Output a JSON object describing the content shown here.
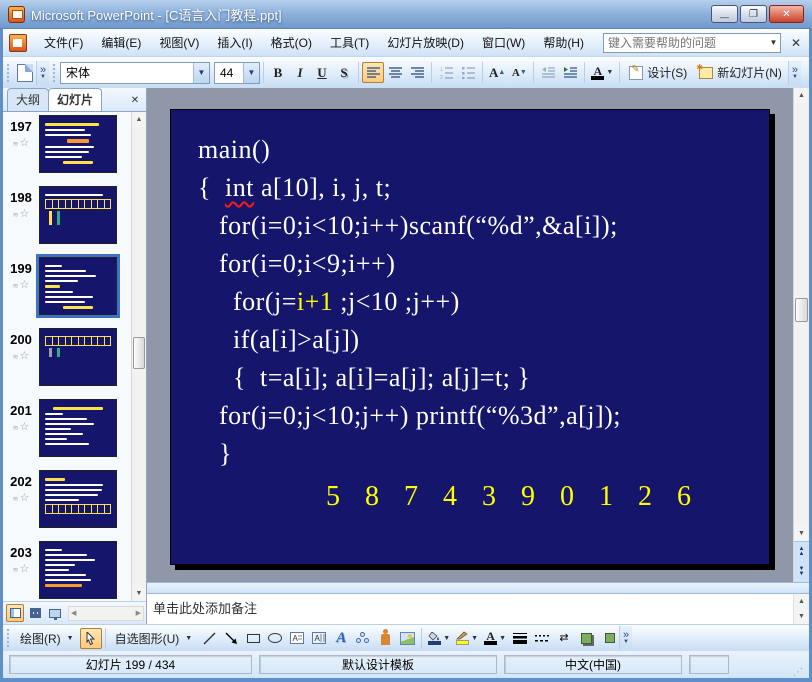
{
  "window": {
    "title": "Microsoft PowerPoint - [C语言入门教程.ppt]"
  },
  "menu": {
    "items": [
      {
        "key": "file",
        "label": "文件(F)"
      },
      {
        "key": "edit",
        "label": "编辑(E)"
      },
      {
        "key": "view",
        "label": "视图(V)"
      },
      {
        "key": "insert",
        "label": "插入(I)"
      },
      {
        "key": "format",
        "label": "格式(O)"
      },
      {
        "key": "tools",
        "label": "工具(T)"
      },
      {
        "key": "slideshow",
        "label": "幻灯片放映(D)"
      },
      {
        "key": "window",
        "label": "窗口(W)"
      },
      {
        "key": "help",
        "label": "帮助(H)"
      }
    ],
    "help_placeholder": "键入需要帮助的问题"
  },
  "format_toolbar": {
    "font_name": "宋体",
    "font_size": "44",
    "bold": "B",
    "italic": "I",
    "underline": "U",
    "shadow": "S",
    "font_grow": "A",
    "font_shrink": "A",
    "font_color": "A",
    "design": "设计(S)",
    "new_slide": "新幻灯片(N)"
  },
  "slides_panel": {
    "tabs": {
      "outline": "大纲",
      "slides": "幻灯片"
    },
    "thumbnails": [
      {
        "number": "197",
        "variant": "title-text",
        "selected": false
      },
      {
        "number": "198",
        "variant": "array-boxes",
        "selected": false
      },
      {
        "number": "199",
        "variant": "code-text",
        "selected": true
      },
      {
        "number": "200",
        "variant": "array-boxes-top",
        "selected": false
      },
      {
        "number": "201",
        "variant": "title-text2",
        "selected": false
      },
      {
        "number": "202",
        "variant": "text-boxes-bottom",
        "selected": false
      },
      {
        "number": "203",
        "variant": "code-text2",
        "selected": false
      }
    ]
  },
  "slide": {
    "code_lines": [
      {
        "segments": [
          {
            "text": "main()"
          }
        ]
      },
      {
        "segments": [
          {
            "text": "{  "
          },
          {
            "text": "int",
            "style": "misspelled"
          },
          {
            "text": " a[10], i, j, t;"
          }
        ]
      },
      {
        "segments": [
          {
            "text": "   for(i=0;i<10;i++)scanf(“%d”,&a[i]);"
          }
        ]
      },
      {
        "segments": [
          {
            "text": "   for(i=0;i<9;i++)"
          }
        ]
      },
      {
        "segments": [
          {
            "text": "     for(j="
          },
          {
            "text": "i+1",
            "style": "highlight"
          },
          {
            "text": " ;j<10 ;j++)"
          }
        ]
      },
      {
        "segments": [
          {
            "text": "     if(a[i]>a[j])"
          }
        ]
      },
      {
        "segments": [
          {
            "text": "     {  t=a[i]; a[i]=a[j]; a[j]=t; }"
          }
        ]
      },
      {
        "segments": [
          {
            "text": "   for(j=0;j<10;j++) printf(“%3d”,a[j]);"
          }
        ]
      },
      {
        "segments": [
          {
            "text": "   }"
          }
        ]
      }
    ],
    "output_line": "5 8 7 4 3 9 0 1 2 6"
  },
  "notes": {
    "placeholder": "单击此处添加备注"
  },
  "drawing_toolbar": {
    "draw": "绘图(R)",
    "autoshapes": "自选图形(U)"
  },
  "status_bar": {
    "slide_info": "幻灯片 199 / 434",
    "design_template": "默认设计模板",
    "language": "中文(中国)"
  },
  "icons": {
    "chevron_down": "▼",
    "close": "✕",
    "minimize": "—",
    "restore": "❐"
  },
  "colors": {
    "slide_background": "#15156b",
    "code_text": "#ffffff",
    "highlight_text": "#ffff00",
    "titlebar_blue": "#7099cc",
    "workspace_gray": "#9097a8",
    "toolbar_blue": "#dfecfa",
    "fill_color_swatch": "#1f3d7a",
    "line_color_swatch": "#ffff00",
    "font_color_swatch": "#000000"
  }
}
